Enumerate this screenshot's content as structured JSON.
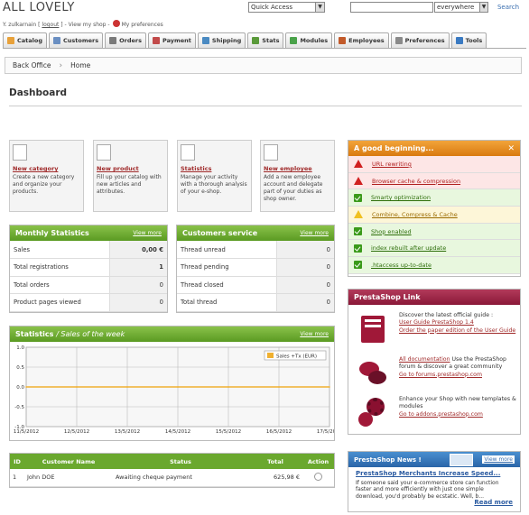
{
  "header": {
    "shop_title": "ALL LOVELY",
    "user_name": "Y. zulkarnain",
    "logout": "logout",
    "view_shop": "View my shop",
    "preferences": "My preferences",
    "quick_access": "Quick Access",
    "search_scope": "everywhere",
    "search_button": "Search"
  },
  "tabs": [
    {
      "label": "Catalog",
      "color": "#e8a13a"
    },
    {
      "label": "Customers",
      "color": "#6a8fc2"
    },
    {
      "label": "Orders",
      "color": "#7a7a7a"
    },
    {
      "label": "Payment",
      "color": "#c24a4a"
    },
    {
      "label": "Shipping",
      "color": "#4a8ac2"
    },
    {
      "label": "Stats",
      "color": "#5a9a3a"
    },
    {
      "label": "Modules",
      "color": "#4aa24a"
    },
    {
      "label": "Employees",
      "color": "#c25a2a"
    },
    {
      "label": "Preferences",
      "color": "#8a8a8a"
    },
    {
      "label": "Tools",
      "color": "#3a7ac2"
    }
  ],
  "breadcrumb": {
    "back_office": "Back Office",
    "sep": "›",
    "home": "Home"
  },
  "page_title": "Dashboard",
  "quick_links": [
    {
      "title": "New category",
      "desc": "Create a new category and organize your products."
    },
    {
      "title": "New product",
      "desc": "Fill up your catalog with new articles and attributes."
    },
    {
      "title": "Statistics",
      "desc": "Manage your activity with a thorough analysis of your e-shop."
    },
    {
      "title": "New employee",
      "desc": "Add a new employee account and delegate part of your duties as shop owner."
    }
  ],
  "monthly": {
    "title": "Monthly Statistics",
    "view_more": "View more",
    "rows": [
      {
        "label": "Sales",
        "value": "0,00 €"
      },
      {
        "label": "Total registrations",
        "value": "1"
      },
      {
        "label": "Total orders",
        "value": "0"
      },
      {
        "label": "Product pages viewed",
        "value": "0"
      }
    ]
  },
  "customer_service": {
    "title": "Customers service",
    "view_more": "View more",
    "rows": [
      {
        "label": "Thread unread",
        "value": "0"
      },
      {
        "label": "Thread pending",
        "value": "0"
      },
      {
        "label": "Thread closed",
        "value": "0"
      },
      {
        "label": "Total thread",
        "value": "0"
      }
    ]
  },
  "stats": {
    "title": "Statistics",
    "subtitle": "/ Sales of the week",
    "view_more": "View more"
  },
  "chart_data": {
    "type": "line",
    "title": "",
    "xlabel": "",
    "ylabel": "",
    "x": [
      "11/5/2012",
      "12/5/2012",
      "13/5/2012",
      "14/5/2012",
      "15/5/2012",
      "16/5/2012",
      "17/5/2012"
    ],
    "x_ticks": [
      "11/5/2012",
      "12/5/2012",
      "13/5/2012",
      "14/5/2012",
      "15/5/2012",
      "16/5/2012",
      "17/5/2012"
    ],
    "y_ticks": [
      "1.0",
      "0.5",
      "0.0",
      "-0.5",
      "-1.0"
    ],
    "ylim": [
      -1.0,
      1.0
    ],
    "grid": true,
    "legend": "top-right",
    "series": [
      {
        "name": "Sales +Tx (EUR)",
        "values": [
          0,
          0,
          0,
          0,
          0,
          0,
          0
        ],
        "color": "#f0b030"
      }
    ]
  },
  "orders": {
    "columns": [
      "ID",
      "Customer Name",
      "Status",
      "Total",
      "Action"
    ],
    "rows": [
      {
        "id": "1",
        "name": "John DOE",
        "status": "Awaiting cheque payment",
        "total": "625,98 €"
      }
    ]
  },
  "good_beginning": {
    "title": "A good beginning...",
    "items": [
      {
        "label": "URL rewriting",
        "state": "bad"
      },
      {
        "label": "Browser cache & compression",
        "state": "bad"
      },
      {
        "label": "Smarty optimization",
        "state": "ok"
      },
      {
        "label": "Combine, Compress & Cache",
        "state": "warn"
      },
      {
        "label": "Shop enabled",
        "state": "ok"
      },
      {
        "label": "index rebuilt after update",
        "state": "ok"
      },
      {
        "label": ".htaccess up-to-date",
        "state": "ok"
      }
    ]
  },
  "prestashop_link": {
    "title": "PrestaShop Link",
    "guide_intro": "Discover the latest official guide :",
    "guide_link": "User Guide PrestaShop 1.4",
    "paper_link": "Order the paper edition of the User Guide",
    "doc_link": "All documentation",
    "forum_text": "Use the PrestaShop forum & discover a great community",
    "forum_link": "Go to forums.prestashop.com",
    "addons_text": "Enhance your Shop with new templates & modules",
    "addons_link": "Go to addons.prestashop.com"
  },
  "news": {
    "title": "PrestaShop News !",
    "view_more": "View more",
    "headline": "PrestaShop Merchants Increase Speed...",
    "body": "If someone said your e-commerce store can function faster and more efficiently with just one simple download, you'd probably be ecstatic. Well, b...",
    "read_more": "Read more"
  }
}
